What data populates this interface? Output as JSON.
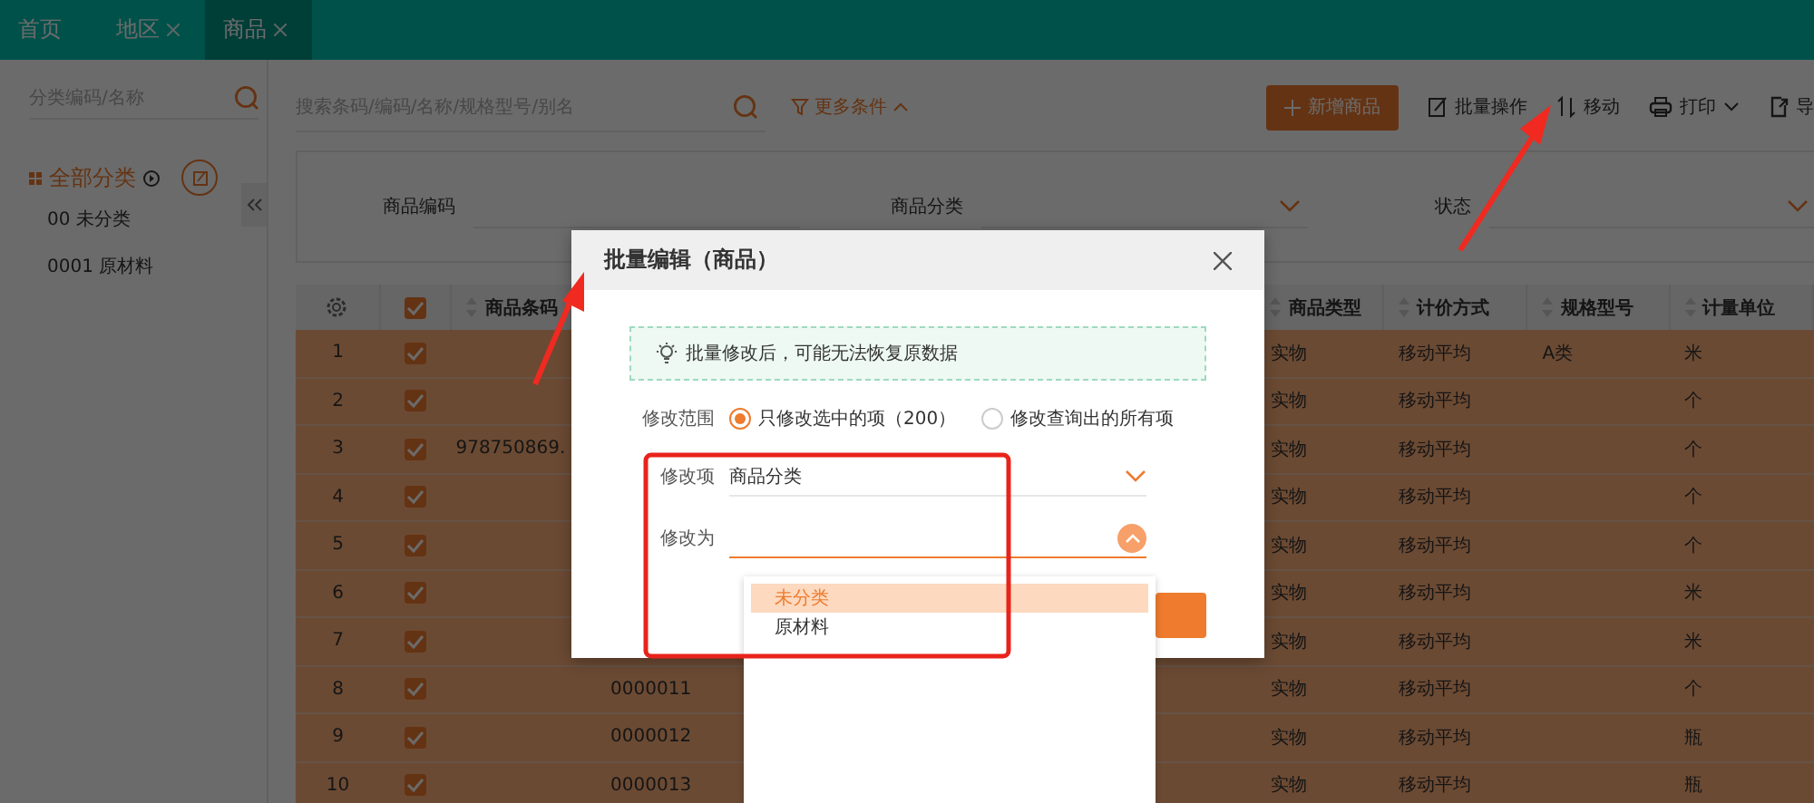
{
  "tabs": [
    {
      "label": "首页",
      "closable": false,
      "selected": false
    },
    {
      "label": "地区",
      "closable": true,
      "selected": false
    },
    {
      "label": "商品",
      "closable": true,
      "selected": true
    }
  ],
  "sidebar": {
    "search_placeholder": "分类编码/名称",
    "root": "全部分类",
    "items": [
      {
        "label": "00 未分类"
      },
      {
        "label": "0001 原材料"
      }
    ]
  },
  "toolbar": {
    "search_placeholder": "搜索条码/编码/名称/规格型号/别名",
    "more_filters": "更多条件",
    "add_button": "新增商品",
    "actions": [
      {
        "label": "批量操作",
        "kind": "edit",
        "dropdown": false
      },
      {
        "label": "移动",
        "kind": "move",
        "dropdown": false
      },
      {
        "label": "打印",
        "kind": "print",
        "dropdown": true
      },
      {
        "label": "导",
        "kind": "export",
        "dropdown": false
      }
    ]
  },
  "filters": [
    {
      "label": "商品编码",
      "kind": "text"
    },
    {
      "label": "商品分类",
      "kind": "select"
    },
    {
      "label": "状态",
      "kind": "select"
    }
  ],
  "table": {
    "header_checked": true,
    "columns": [
      "商品条码",
      "商品类型",
      "计价方式",
      "规格型号",
      "计量单位"
    ],
    "rows": [
      {
        "index": "1",
        "checked": true,
        "type": "实物",
        "pricing": "移动平均",
        "spec": "A类",
        "unit": "米"
      },
      {
        "index": "2",
        "checked": true,
        "type": "实物",
        "pricing": "移动平均",
        "unit": "个"
      },
      {
        "index": "3",
        "checked": true,
        "barcode": "978750869.",
        "type": "实物",
        "pricing": "移动平均",
        "unit": "个"
      },
      {
        "index": "4",
        "checked": true,
        "type": "实物",
        "pricing": "移动平均",
        "unit": "个"
      },
      {
        "index": "5",
        "checked": true,
        "type": "实物",
        "pricing": "移动平均",
        "unit": "个"
      },
      {
        "index": "6",
        "checked": true,
        "type": "实物",
        "pricing": "移动平均",
        "unit": "米"
      },
      {
        "index": "7",
        "checked": true,
        "type": "实物",
        "pricing": "移动平均",
        "unit": "米"
      },
      {
        "index": "8",
        "checked": true,
        "code": "0000011",
        "type": "实物",
        "pricing": "移动平均",
        "unit": "个"
      },
      {
        "index": "9",
        "checked": true,
        "code": "0000012",
        "type": "实物",
        "pricing": "移动平均",
        "unit": "瓶"
      },
      {
        "index": "10",
        "checked": true,
        "code": "0000013",
        "type": "实物",
        "pricing": "移动平均",
        "unit": "瓶"
      }
    ]
  },
  "dialog": {
    "title": "批量编辑（商品）",
    "notice": "批量修改后，可能无法恢复原数据",
    "scope_label": "修改范围",
    "scope_options": [
      {
        "label": "只修改选中的项（200）",
        "selected": true
      },
      {
        "label": "修改查询出的所有项",
        "selected": false
      }
    ],
    "field_label": "修改项",
    "field_value": "商品分类",
    "target_label": "修改为",
    "target_open": true,
    "options": [
      {
        "label": "未分类",
        "selected": true
      },
      {
        "label": "原材料",
        "selected": false
      }
    ]
  }
}
